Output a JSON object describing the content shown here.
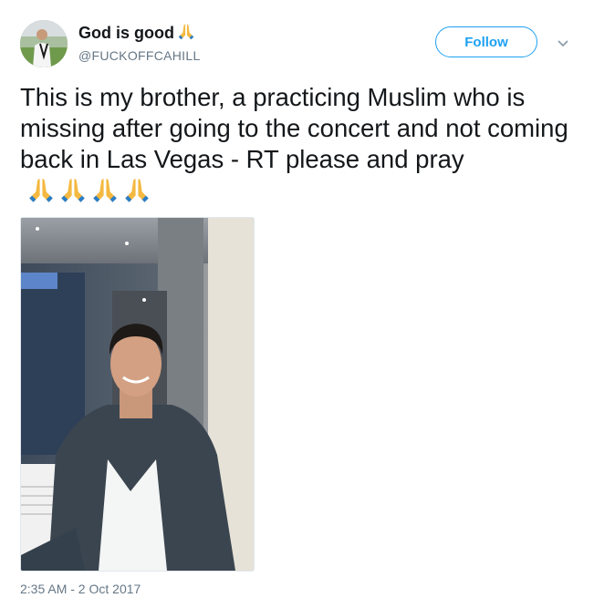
{
  "user": {
    "display_name": "God is good",
    "handle": "@FUCKOFFCAHILL"
  },
  "follow_button": {
    "label": "Follow"
  },
  "tweet": {
    "text": "This is my brother, a practicing Muslim who is missing after going to the concert and not coming back in Las Vegas - RT please and pray",
    "pray_emoji_count": 4,
    "timestamp": "2:35 AM - 2 Oct 2017"
  },
  "colors": {
    "accent": "#1da1f2",
    "text": "#14171a",
    "secondary": "#657786"
  },
  "icons": {
    "emoji": "folded-hands-icon",
    "menu": "chevron-down-icon"
  }
}
